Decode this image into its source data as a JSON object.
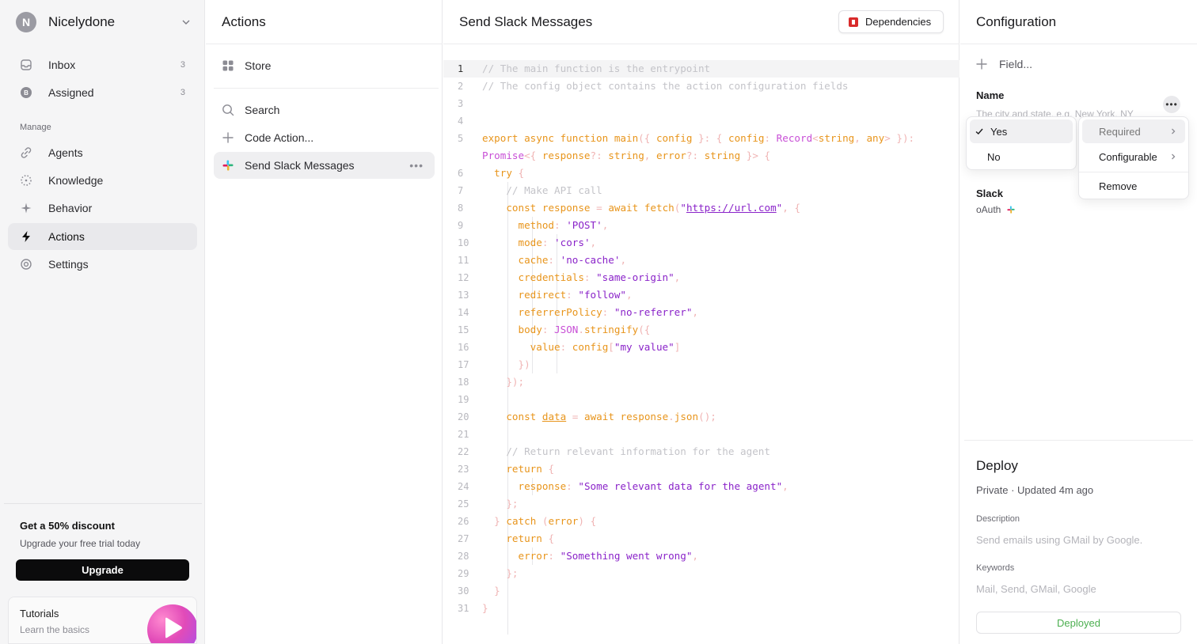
{
  "sidebar": {
    "workspace_initial": "N",
    "workspace_name": "Nicelydone",
    "items_top": [
      {
        "label": "Inbox",
        "count": "3",
        "icon": "inbox-icon"
      },
      {
        "label": "Assigned",
        "count": "3",
        "icon": "assigned-icon"
      }
    ],
    "manage_label": "Manage",
    "items_manage": [
      {
        "label": "Agents",
        "icon": "link-icon"
      },
      {
        "label": "Knowledge",
        "icon": "dotted-circle-icon"
      },
      {
        "label": "Behavior",
        "icon": "sparkle-icon"
      },
      {
        "label": "Actions",
        "icon": "bolt-icon",
        "active": true
      },
      {
        "label": "Settings",
        "icon": "settings-icon"
      }
    ],
    "promo": {
      "title": "Get a 50% discount",
      "subtitle": "Upgrade your free trial today",
      "button": "Upgrade"
    },
    "tutorials": {
      "title": "Tutorials",
      "subtitle": "Learn the basics"
    }
  },
  "actions": {
    "title": "Actions",
    "store_label": "Store",
    "search_label": "Search",
    "code_action_label": "Code Action...",
    "items": [
      {
        "label": "Send Slack Messages",
        "more": "•••"
      }
    ]
  },
  "editor": {
    "title": "Send Slack Messages",
    "dependencies_label": "Dependencies",
    "line_numbers": [
      "1",
      "2",
      "3",
      "4",
      "5",
      "",
      "6",
      "7",
      "8",
      "9",
      "10",
      "11",
      "12",
      "13",
      "14",
      "15",
      "16",
      "17",
      "18",
      "19",
      "20",
      "21",
      "22",
      "23",
      "24",
      "25",
      "26",
      "27",
      "28",
      "29",
      "30",
      "31"
    ]
  },
  "config": {
    "title": "Configuration",
    "add_field_label": "Field...",
    "name_label": "Name",
    "name_placeholder": "The city and state, e.g. New York, NY",
    "more_label": "•••",
    "slack_label": "Slack",
    "slack_sub": "oAuth",
    "submenu": {
      "yes": "Yes",
      "no": "No"
    },
    "menu": {
      "required": "Required",
      "configurable": "Configurable",
      "remove": "Remove"
    },
    "deploy": {
      "title": "Deploy",
      "meta": "Private · Updated 4m ago",
      "description_label": "Description",
      "description": "Send emails using GMail by Google.",
      "keywords_label": "Keywords",
      "keywords": "Mail, Send, GMail, Google",
      "button": "Deployed"
    }
  },
  "colors": {
    "accent_dark": "#0b0b0c",
    "deployed_green": "#4caf50",
    "dependency_red": "#d92b2b"
  }
}
